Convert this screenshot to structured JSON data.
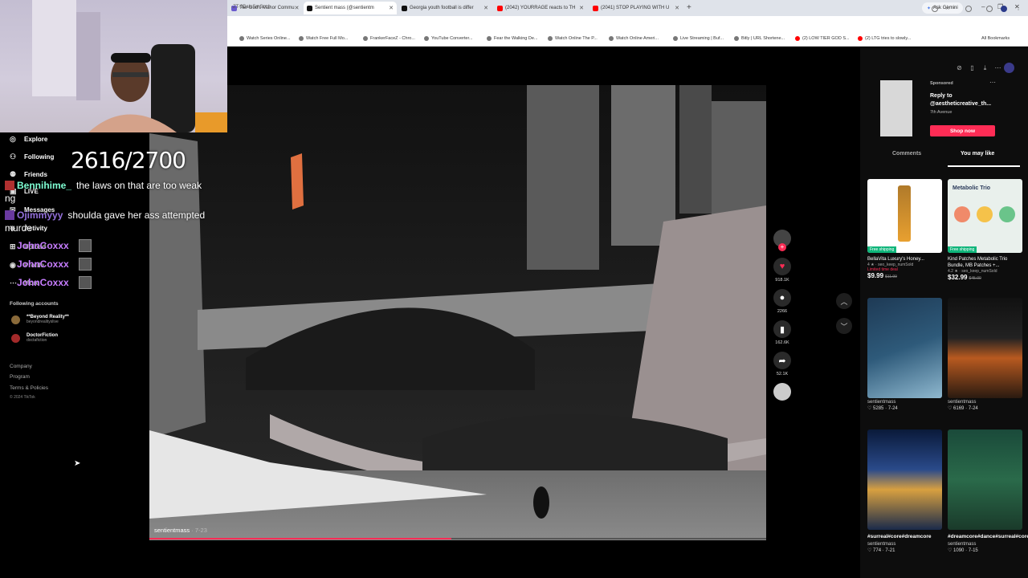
{
  "browser": {
    "tabs": [
      {
        "title": "Tier God's Manor Commu",
        "color": "#6a5acd"
      },
      {
        "title": "Sentient mass (@sentientm",
        "color": "#111111",
        "active": true
      },
      {
        "title": "Georgia youth football is differ",
        "color": "#111111"
      },
      {
        "title": "(2042) YOURRAGE reacts to TH",
        "color": "#ff0000"
      },
      {
        "title": "(2041) STOP PLAYING WITH U",
        "color": "#ff0000"
      }
    ],
    "ask_gemini": "Ask Gemini",
    "url": "-ZT-9BaloSmSoch",
    "bookmarks": [
      "Watch Series Online...",
      "Watch Free Full Mo...",
      "FrankerFaceZ - Chro...",
      "YouTube Converter...",
      "Fear the Walking De...",
      "Watch Online The P...",
      "Watch Online Ameri...",
      "Live Streaming | Buf...",
      "Bitly | URL Shortene...",
      "(2) LOW TIER GOD S...",
      "(2) LTG tries to slowly..."
    ],
    "all_bookmarks": "All Bookmarks"
  },
  "sidebar": {
    "items": [
      {
        "label": "Explore",
        "icon": "compass-icon",
        "glyph": "◎"
      },
      {
        "label": "Following",
        "icon": "following-icon",
        "glyph": "⚇"
      },
      {
        "label": "Friends",
        "icon": "friends-icon",
        "glyph": "⚉"
      },
      {
        "label": "LIVE",
        "icon": "live-icon",
        "glyph": "▣"
      },
      {
        "label": "Messages",
        "icon": "messages-icon",
        "glyph": "✉"
      },
      {
        "label": "Activity",
        "icon": "activity-icon",
        "glyph": "◈"
      },
      {
        "label": "Upload",
        "icon": "upload-icon",
        "glyph": "⊞"
      },
      {
        "label": "Profile",
        "icon": "profile-icon",
        "glyph": "◉"
      },
      {
        "label": "More",
        "icon": "more-icon",
        "glyph": "⋯"
      }
    ],
    "following_heading": "Following accounts",
    "accounts": [
      {
        "name": "**Beyond Reality**",
        "handle": "beyondrealityslive"
      },
      {
        "name": "DoctorFiction",
        "handle": "doctafiction"
      }
    ],
    "footer": [
      "Company",
      "Program",
      "Terms & Policies"
    ],
    "copyright": "© 2024 TikTok"
  },
  "overlay": {
    "counter": "2616/2700",
    "chat": [
      {
        "user": "Bennihime_",
        "user_color": "#7fffd4",
        "message": "the laws on that are too weak"
      },
      {
        "user": "Ojimmyyy",
        "user_color": "#9370db",
        "message": "shoulda gave her ass attempted"
      },
      {
        "user": "JohnCoxxx",
        "user_color": "#c77dff",
        "message": ""
      },
      {
        "user": "JohnCoxxx",
        "user_color": "#c77dff",
        "message": ""
      },
      {
        "user": "JohnCoxxx",
        "user_color": "#c77dff",
        "message": ""
      }
    ],
    "chat_wrap_fragments": [
      "ng",
      "murde"
    ]
  },
  "video": {
    "author": "sentientmass",
    "date": "7-23",
    "progress": 0.49
  },
  "actions": {
    "likes": "918.1K",
    "comments": "2266",
    "saves": "162.6K",
    "shares": "52.1K"
  },
  "right_panel": {
    "ad": {
      "sponsored": "Sponsored",
      "title": "Reply to @aestheticreative_th...",
      "subtitle": "7th Avenue",
      "cta": "Shop now"
    },
    "tabs": [
      "Comments",
      "You may like"
    ],
    "products": [
      {
        "title": "BellaVita Luxury's Honey...",
        "rating": "4",
        "seller": "seo_keep_numSold",
        "deal": "Limited time deal",
        "price": "$9.99",
        "old_price": "$11.99",
        "shipping": "Free shipping"
      },
      {
        "title": "Kind Patches Metabolic Trio Bundle, MB Patches +...",
        "rating": "4.2",
        "seller": "seo_keep_numSold",
        "price": "$32.99",
        "old_price": "$45.00",
        "shipping": "Free shipping",
        "label": "Metabolic Trio"
      }
    ],
    "videos": [
      {
        "title": "",
        "author": "sentientmass",
        "likes": "5285",
        "date": "7-24"
      },
      {
        "title": "",
        "author": "sentientmass",
        "likes": "6169",
        "date": "7-24"
      },
      {
        "title": "#surreal#core#dreamcore",
        "author": "sentientmass",
        "likes": "774",
        "date": "7-21"
      },
      {
        "title": "#dreamcore#dance#surreal#core",
        "author": "sentientmass",
        "likes": "1090",
        "date": "7-15"
      }
    ]
  }
}
